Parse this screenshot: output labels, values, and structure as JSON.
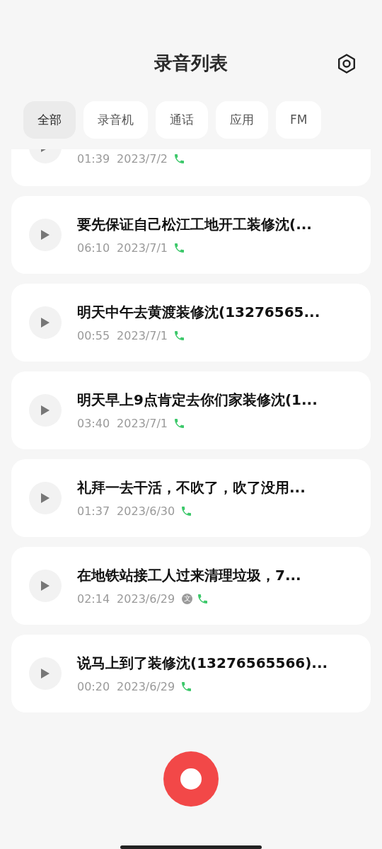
{
  "header": {
    "title": "录音列表"
  },
  "tabs": [
    {
      "label": "全部",
      "selected": true
    },
    {
      "label": "录音机",
      "selected": false
    },
    {
      "label": "通话",
      "selected": false
    },
    {
      "label": "应用",
      "selected": false
    },
    {
      "label": "FM",
      "selected": false
    }
  ],
  "recordings": [
    {
      "kind": "partial",
      "duration": "01:39",
      "date": "2023/7/2"
    },
    {
      "kind": "full",
      "title": "要先保证自己松江工地开工装修沈(...",
      "duration": "06:10",
      "date": "2023/7/1"
    },
    {
      "kind": "full",
      "title": "明天中午去黄渡装修沈(13276565...",
      "duration": "00:55",
      "date": "2023/7/1"
    },
    {
      "kind": "full",
      "title": "明天早上9点肯定去你们家装修沈(1...",
      "duration": "03:40",
      "date": "2023/7/1"
    },
    {
      "kind": "full",
      "title": "礼拜一去干活，不吹了，吹了没用...",
      "duration": "01:37",
      "date": "2023/6/30"
    },
    {
      "kind": "full",
      "title": "在地铁站接工人过来清理垃圾，7...",
      "duration": "02:14",
      "date": "2023/6/29",
      "badge": "文"
    },
    {
      "kind": "full",
      "title": "说马上到了装修沈(13276565566)...",
      "duration": "00:20",
      "date": "2023/6/29"
    }
  ]
}
